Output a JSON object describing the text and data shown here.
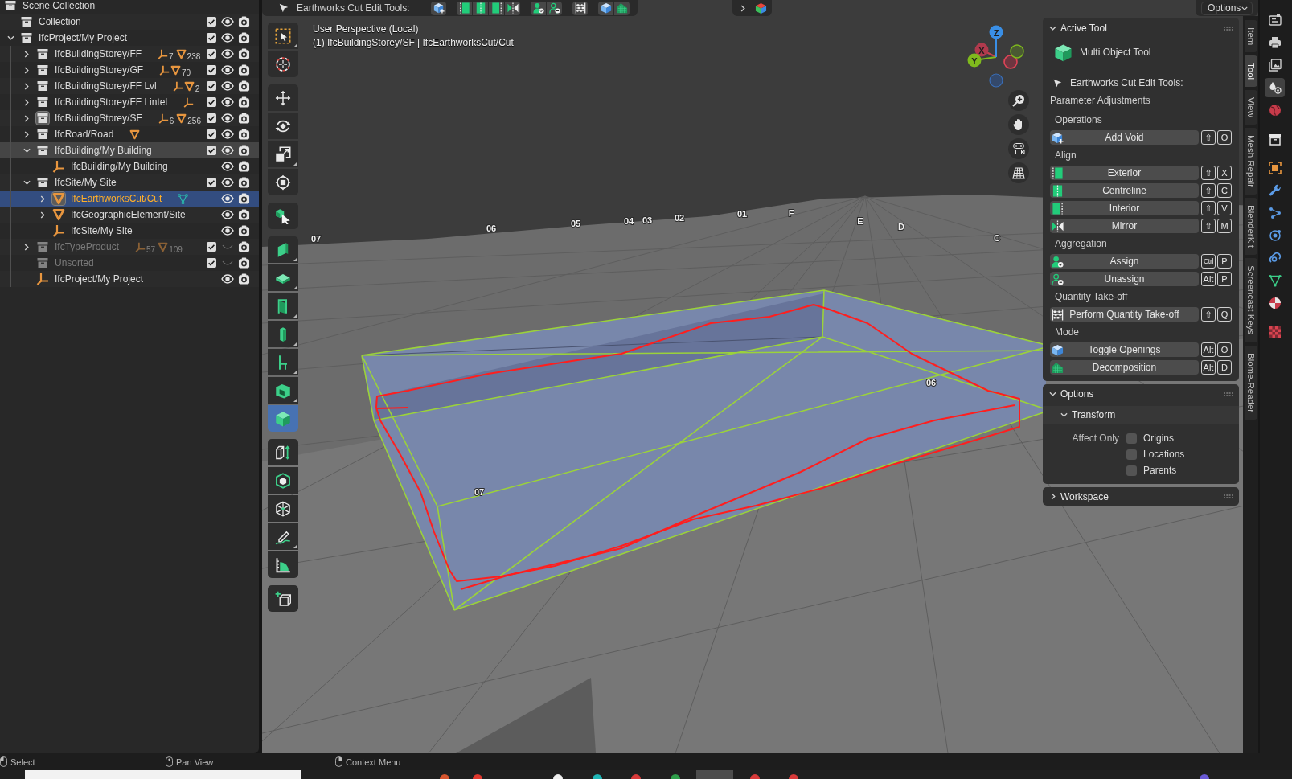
{
  "outliner": {
    "root": {
      "label": "Scene Collection",
      "children": [
        {
          "label": "Collection",
          "kind": "collection",
          "checked": true,
          "visible": true,
          "selected": false,
          "active": false,
          "highlighted": false
        },
        {
          "label": "IfcProject/My Project",
          "kind": "collection",
          "expanded": true,
          "checked": true,
          "visible": true,
          "selected": false,
          "active": false,
          "highlighted": false,
          "children": [
            {
              "label": "IfcBuildingStorey/FF",
              "kind": "collection",
              "expanded": false,
              "checked": true,
              "visible": true,
              "selected": false,
              "active": false,
              "highlighted": false,
              "contents": [
                {
                  "kind": "empty",
                  "count": "7"
                },
                {
                  "kind": "mesh",
                  "count": "238"
                }
              ]
            },
            {
              "label": "IfcBuildingStorey/GF",
              "kind": "collection",
              "expanded": false,
              "checked": true,
              "visible": true,
              "selected": false,
              "active": false,
              "highlighted": false,
              "contents": [
                {
                  "kind": "empty"
                },
                {
                  "kind": "mesh",
                  "count": "70"
                }
              ]
            },
            {
              "label": "IfcBuildingStorey/FF Lvl",
              "kind": "collection",
              "expanded": false,
              "checked": true,
              "visible": true,
              "selected": false,
              "active": false,
              "highlighted": false,
              "contents": [
                {
                  "kind": "empty"
                },
                {
                  "kind": "mesh",
                  "count": "2"
                }
              ]
            },
            {
              "label": "IfcBuildingStorey/FF Lintel",
              "kind": "collection",
              "expanded": false,
              "checked": true,
              "visible": true,
              "selected": false,
              "active": false,
              "highlighted": false,
              "contents": [
                {
                  "kind": "empty"
                }
              ]
            },
            {
              "label": "IfcBuildingStorey/SF",
              "kind": "collection",
              "expanded": false,
              "checked": true,
              "visible": true,
              "selected": false,
              "active": true,
              "highlighted": false,
              "contents": [
                {
                  "kind": "empty",
                  "count": "6"
                },
                {
                  "kind": "mesh",
                  "count": "256"
                }
              ]
            },
            {
              "label": "IfcRoad/Road",
              "kind": "collection",
              "expanded": false,
              "checked": true,
              "visible": true,
              "selected": false,
              "active": false,
              "highlighted": false,
              "contents": [
                {
                  "kind": "mesh"
                }
              ]
            },
            {
              "label": "IfcBuilding/My Building",
              "kind": "collection",
              "expanded": true,
              "checked": true,
              "visible": true,
              "selected": false,
              "active": false,
              "highlighted": true,
              "children": [
                {
                  "label": "IfcBuilding/My Building",
                  "kind": "empty",
                  "visible": true,
                  "selected": false,
                  "active": false,
                  "highlighted": false
                }
              ]
            },
            {
              "label": "IfcSite/My Site",
              "kind": "collection",
              "expanded": true,
              "checked": true,
              "visible": true,
              "selected": false,
              "active": false,
              "highlighted": false,
              "children": [
                {
                  "label": "IfcEarthworksCut/Cut",
                  "kind": "mesh",
                  "expanded": false,
                  "visible": true,
                  "selected": true,
                  "active": true,
                  "highlighted": false,
                  "contents": [
                    {
                      "kind": "mesh_data"
                    }
                  ]
                },
                {
                  "label": "IfcGeographicElement/Site",
                  "kind": "mesh",
                  "expanded": false,
                  "visible": true,
                  "selected": false,
                  "active": false,
                  "highlighted": false
                },
                {
                  "label": "IfcSite/My Site",
                  "kind": "empty",
                  "visible": true,
                  "selected": false,
                  "active": false,
                  "highlighted": false
                }
              ]
            },
            {
              "label": "IfcTypeProduct",
              "kind": "collection",
              "expanded": false,
              "checked": true,
              "visible": false,
              "selected": false,
              "active": false,
              "highlighted": false,
              "contents": [
                {
                  "kind": "empty",
                  "count": "57"
                },
                {
                  "kind": "mesh",
                  "count": "109"
                }
              ]
            },
            {
              "label": "Unsorted",
              "kind": "collection",
              "checked": true,
              "visible": false,
              "selected": false,
              "active": false,
              "highlighted": false
            },
            {
              "label": "IfcProject/My Project",
              "kind": "empty",
              "visible": true,
              "selected": false,
              "active": false,
              "highlighted": false
            }
          ]
        }
      ]
    }
  },
  "viewport": {
    "header": {
      "title": "Earthworks Cut Edit Tools:",
      "options": "Options"
    },
    "overlay": {
      "view_name": "User Perspective (Local)",
      "object_info": "(1) IfcBuildingStorey/SF | IfcEarthworksCut/Cut"
    },
    "toolbar": [
      [
        {
          "kind": "select_box",
          "selected": false,
          "submenu": true
        },
        {
          "kind": "cursor",
          "selected": false,
          "submenu": false
        }
      ],
      [
        {
          "kind": "move",
          "selected": false,
          "submenu": false
        },
        {
          "kind": "rotate",
          "selected": false,
          "submenu": false
        },
        {
          "kind": "scale",
          "selected": false,
          "submenu": true
        },
        {
          "kind": "transform",
          "selected": false,
          "submenu": false
        }
      ],
      [
        {
          "kind": "select_object",
          "selected": false,
          "submenu": false
        }
      ],
      [
        {
          "kind": "wall",
          "selected": false,
          "submenu": true
        },
        {
          "kind": "slab",
          "selected": false,
          "submenu": true
        },
        {
          "kind": "door",
          "selected": false,
          "submenu": true
        },
        {
          "kind": "column",
          "selected": false,
          "submenu": true
        },
        {
          "kind": "chair",
          "selected": false,
          "submenu": true
        },
        {
          "kind": "opening",
          "selected": false,
          "submenu": true
        },
        {
          "kind": "cube",
          "selected": true,
          "submenu": false
        }
      ],
      [
        {
          "kind": "measure_height",
          "selected": false,
          "submenu": false
        },
        {
          "kind": "inner_cube",
          "selected": false,
          "submenu": false
        },
        {
          "kind": "wireframe",
          "selected": false,
          "submenu": false
        },
        {
          "kind": "annotate",
          "selected": false,
          "submenu": true
        },
        {
          "kind": "measure",
          "selected": false,
          "submenu": false
        }
      ],
      [
        {
          "kind": "add_cube",
          "selected": false,
          "submenu": false
        }
      ]
    ],
    "gizmo": [
      {
        "kind": "x",
        "label": "X"
      },
      {
        "kind": "y",
        "label": "Y"
      },
      {
        "kind": "z",
        "label": "Z"
      }
    ],
    "grid_labels": [
      "07",
      "06",
      "05",
      "04",
      "03",
      "02",
      "01",
      "F",
      "E",
      "D",
      "C",
      "06",
      "07"
    ]
  },
  "sidebar": {
    "tabs": [
      {
        "label": "Item",
        "selected": false
      },
      {
        "label": "Tool",
        "selected": true
      },
      {
        "label": "View",
        "selected": false
      },
      {
        "label": "Mesh Repair",
        "selected": false
      },
      {
        "label": "BlenderKit",
        "selected": false
      },
      {
        "label": "Screencast Keys",
        "selected": false
      },
      {
        "label": "Biome-Reader",
        "selected": false
      }
    ],
    "active_tool": {
      "title": "Active Tool",
      "expanded": true,
      "tool_name": "Multi Object Tool",
      "tools_label": "Earthworks Cut Edit Tools:",
      "subtitle": "Parameter Adjustments",
      "sections": [
        {
          "title": "Operations",
          "buttons": [
            {
              "kind": "add_void",
              "label": "Add Void",
              "keys": [
                "⇧",
                "O"
              ]
            }
          ]
        },
        {
          "title": "Align",
          "buttons": [
            {
              "kind": "exterior",
              "label": "Exterior",
              "keys": [
                "⇧",
                "X"
              ]
            },
            {
              "kind": "centreline",
              "label": "Centreline",
              "keys": [
                "⇧",
                "C"
              ]
            },
            {
              "kind": "interior",
              "label": "Interior",
              "keys": [
                "⇧",
                "V"
              ]
            },
            {
              "kind": "mirror",
              "label": "Mirror",
              "keys": [
                "⇧",
                "M"
              ]
            }
          ]
        },
        {
          "title": "Aggregation",
          "buttons": [
            {
              "kind": "assign",
              "label": "Assign",
              "keys": [
                "Ctrl",
                "P"
              ]
            },
            {
              "kind": "unassign",
              "label": "Unassign",
              "keys": [
                "Alt",
                "P"
              ]
            }
          ]
        },
        {
          "title": "Quantity Take-off",
          "buttons": [
            {
              "kind": "quantity",
              "label": "Perform Quantity Take-off",
              "keys": [
                "⇧",
                "Q"
              ]
            }
          ]
        },
        {
          "title": "Mode",
          "buttons": [
            {
              "kind": "toggle_openings",
              "label": "Toggle Openings",
              "keys": [
                "Alt",
                "O"
              ]
            },
            {
              "kind": "decomposition",
              "label": "Decomposition",
              "keys": [
                "Alt",
                "D"
              ]
            }
          ]
        }
      ]
    },
    "options": {
      "title": "Options",
      "expanded": true,
      "subpanel": {
        "title": "Transform",
        "expanded": true,
        "label": "Affect Only",
        "checkboxes": [
          {
            "label": "Origins",
            "checked": false
          },
          {
            "label": "Locations",
            "checked": false
          },
          {
            "label": "Parents",
            "checked": false
          }
        ]
      }
    },
    "workspace": {
      "title": "Workspace",
      "expanded": false
    }
  },
  "properties_tabs": [
    [
      {
        "kind": "tool",
        "selected": false
      },
      {
        "kind": "output",
        "selected": false
      },
      {
        "kind": "view_layer",
        "selected": false
      },
      {
        "kind": "scene",
        "selected": true
      },
      {
        "kind": "world",
        "selected": false
      }
    ],
    [
      {
        "kind": "collection",
        "selected": false
      }
    ],
    [
      {
        "kind": "object",
        "selected": false
      },
      {
        "kind": "modifier",
        "selected": false
      },
      {
        "kind": "particles",
        "selected": false
      },
      {
        "kind": "physics",
        "selected": false
      },
      {
        "kind": "constraint",
        "selected": false
      },
      {
        "kind": "data",
        "selected": false
      },
      {
        "kind": "material",
        "selected": false
      }
    ],
    [
      {
        "kind": "texture",
        "selected": false
      }
    ]
  ],
  "status_bar": [
    {
      "kind": "left",
      "label": "Select"
    },
    {
      "kind": "middle",
      "label": "Pan View"
    },
    {
      "kind": "right",
      "label": "Context Menu"
    }
  ]
}
